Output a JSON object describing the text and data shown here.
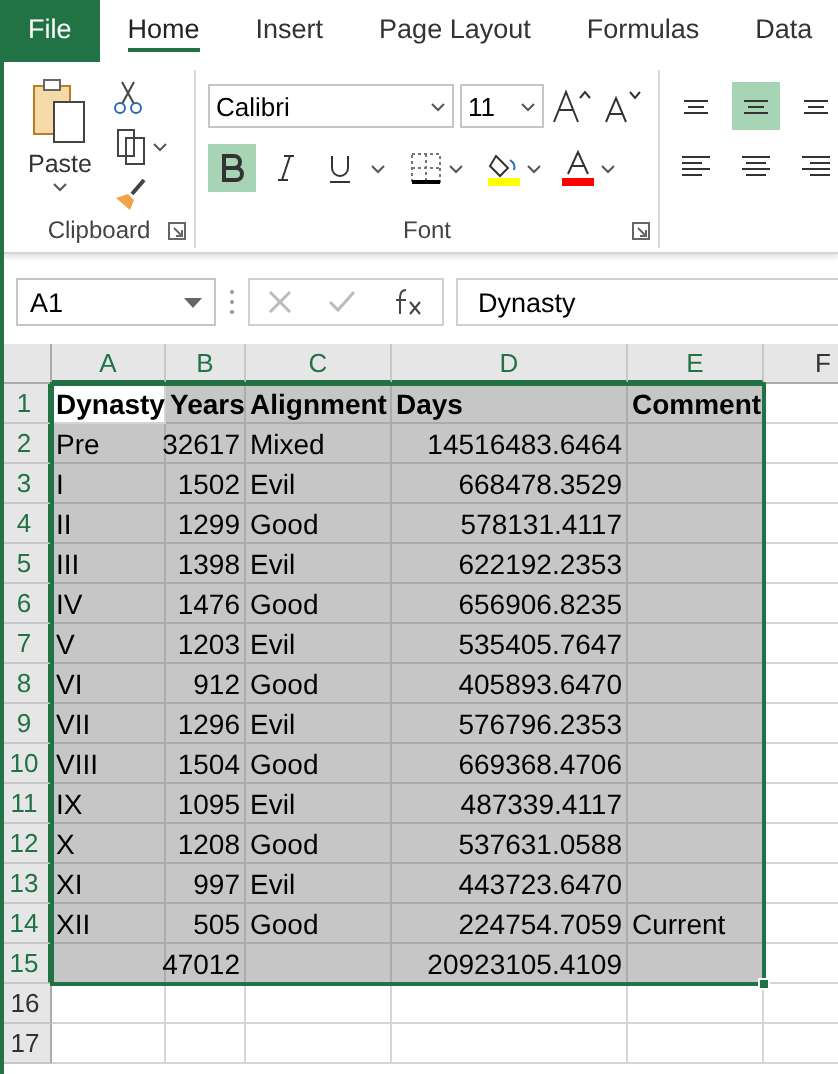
{
  "ribbon_tabs": [
    {
      "label": "File",
      "kind": "file",
      "selected": false
    },
    {
      "label": "Home",
      "kind": "tab",
      "selected": true
    },
    {
      "label": "Insert",
      "kind": "tab",
      "selected": false
    },
    {
      "label": "Page Layout",
      "kind": "tab",
      "selected": false
    },
    {
      "label": "Formulas",
      "kind": "tab",
      "selected": false
    },
    {
      "label": "Data",
      "kind": "tab",
      "selected": false
    }
  ],
  "ribbon": {
    "clipboard": {
      "label": "Clipboard",
      "paste_label": "Paste"
    },
    "font": {
      "label": "Font",
      "font_name": "Calibri",
      "font_size": "11",
      "bold": true,
      "italic": false,
      "underline": false
    },
    "alignment": {
      "top_align": false,
      "middle_align": true,
      "bottom_align": false
    }
  },
  "formula_bar": {
    "name_box": "A1",
    "formula": "Dynasty"
  },
  "sheet": {
    "columns": [
      {
        "label": "A",
        "numeric": false
      },
      {
        "label": "B",
        "numeric": true
      },
      {
        "label": "C",
        "numeric": false
      },
      {
        "label": "D",
        "numeric": true
      },
      {
        "label": "E",
        "numeric": false
      },
      {
        "label": "F",
        "numeric": false
      }
    ],
    "rows": [
      {
        "header": "1",
        "kind": "header",
        "selected": true,
        "active_first": true,
        "cells": [
          "Dynasty",
          "Years",
          "Alignment",
          "Days",
          "Comment"
        ]
      },
      {
        "header": "2",
        "kind": "data",
        "selected": true,
        "active_first": false,
        "cells": [
          "Pre",
          "32617",
          "Mixed",
          "14516483.6464",
          null
        ]
      },
      {
        "header": "3",
        "kind": "data",
        "selected": true,
        "active_first": false,
        "cells": [
          "I",
          "1502",
          "Evil",
          "668478.3529",
          null
        ]
      },
      {
        "header": "4",
        "kind": "data",
        "selected": true,
        "active_first": false,
        "cells": [
          "II",
          "1299",
          "Good",
          "578131.4117",
          null
        ]
      },
      {
        "header": "5",
        "kind": "data",
        "selected": true,
        "active_first": false,
        "cells": [
          "III",
          "1398",
          "Evil",
          "622192.2353",
          null
        ]
      },
      {
        "header": "6",
        "kind": "data",
        "selected": true,
        "active_first": false,
        "cells": [
          "IV",
          "1476",
          "Good",
          "656906.8235",
          null
        ]
      },
      {
        "header": "7",
        "kind": "data",
        "selected": true,
        "active_first": false,
        "cells": [
          "V",
          "1203",
          "Evil",
          "535405.7647",
          null
        ]
      },
      {
        "header": "8",
        "kind": "data",
        "selected": true,
        "active_first": false,
        "cells": [
          "VI",
          "912",
          "Good",
          "405893.6470",
          null
        ]
      },
      {
        "header": "9",
        "kind": "data",
        "selected": true,
        "active_first": false,
        "cells": [
          "VII",
          "1296",
          "Evil",
          "576796.2353",
          null
        ]
      },
      {
        "header": "10",
        "kind": "data",
        "selected": true,
        "active_first": false,
        "cells": [
          "VIII",
          "1504",
          "Good",
          "669368.4706",
          null
        ]
      },
      {
        "header": "11",
        "kind": "data",
        "selected": true,
        "active_first": false,
        "cells": [
          "IX",
          "1095",
          "Evil",
          "487339.4117",
          null
        ]
      },
      {
        "header": "12",
        "kind": "data",
        "selected": true,
        "active_first": false,
        "cells": [
          "X",
          "1208",
          "Good",
          "537631.0588",
          null
        ]
      },
      {
        "header": "13",
        "kind": "data",
        "selected": true,
        "active_first": false,
        "cells": [
          "XI",
          "997",
          "Evil",
          "443723.6470",
          null
        ]
      },
      {
        "header": "14",
        "kind": "data",
        "selected": true,
        "active_first": false,
        "cells": [
          "XII",
          "505",
          "Good",
          "224754.7059",
          "Current"
        ]
      },
      {
        "header": "15",
        "kind": "data",
        "selected": true,
        "active_first": false,
        "cells": [
          null,
          "47012",
          null,
          "20923105.4109",
          null
        ]
      },
      {
        "header": "16",
        "kind": "data",
        "selected": false,
        "active_first": false
      },
      {
        "header": "17",
        "kind": "data",
        "selected": false,
        "active_first": false
      }
    ]
  }
}
